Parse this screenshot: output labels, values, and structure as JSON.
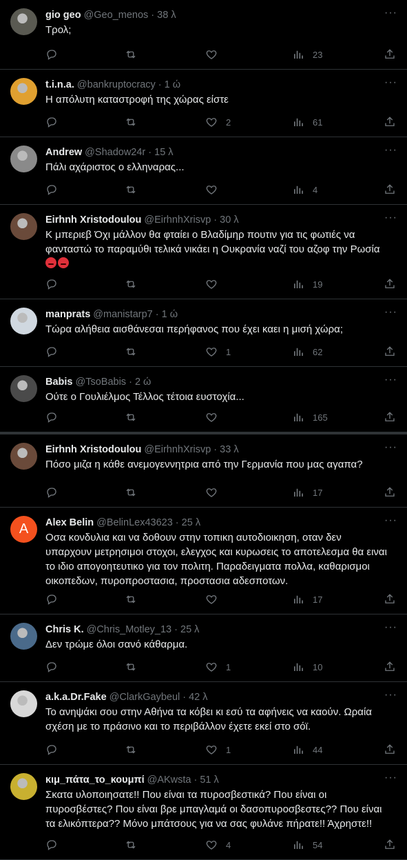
{
  "tweets": [
    {
      "name": "gio geo",
      "meta": "@Geo_menos · 38 λ",
      "text": "Τρολ;",
      "likes": "",
      "views": "23",
      "avatar": "photo",
      "avatar_color": "#5a5a52"
    },
    {
      "name": "t.i.n.a.",
      "meta": "@bankruptocracy · 1 ώ",
      "text": "Η απόλυτη καταστροφή της χώρας είστε",
      "likes": "2",
      "views": "61",
      "avatar": "photo",
      "avatar_color": "#e0a030"
    },
    {
      "name": "Andrew",
      "meta": "@Shadow24r · 15 λ",
      "text": "Πάλι αχάριστος ο ελληναρας...",
      "likes": "",
      "views": "4",
      "avatar": "photo",
      "avatar_color": "#8a8a8a"
    },
    {
      "name": "Eirhnh Xristodoulou",
      "meta": "@EirhnhXrisvp · 30 λ",
      "text": "Κ μπεριεβ Όχι μάλλον θα φταίει ο Βλαδίμηρ πουτιν για τις φωτιές να φανταστώ το παραμύθι τελικά νικάει η Ουκρανία ναζί του αζοφ την Ρωσία",
      "emoji_count": 2,
      "likes": "",
      "views": "19",
      "avatar": "photo",
      "avatar_color": "#6a4a3a"
    },
    {
      "name": "manprats",
      "meta": "@manistarp7 · 1 ώ",
      "text": "Τώρα αλήθεια αισθάνεσαι περήφανος που έχει καει η μισή χώρα;",
      "likes": "1",
      "views": "62",
      "avatar": "photo",
      "avatar_color": "#d0d8e0"
    },
    {
      "name": "Babis",
      "meta": "@TsoBabis · 2 ώ",
      "text": "Ούτε ο Γουλιέλμος Τέλλος τέτοια ευστοχία...",
      "likes": "",
      "views": "165",
      "avatar": "photo",
      "avatar_color": "#4a4a4a"
    },
    {
      "name": "Eirhnh Xristodoulou",
      "meta": "@EirhnhXrisvp · 33 λ",
      "text": "Πόσο μιζα η κάθε ανεμογεννητρια από την Γερμανία που μας αγαπα?",
      "likes": "",
      "views": "17",
      "avatar": "photo",
      "avatar_color": "#6a4a3a"
    },
    {
      "name": "Alex Belin",
      "meta": "@BelinLex43623 · 25 λ",
      "text": "Οσα κονδυλια και να δοθουν στην τοπικη αυτοδιοικηση, οταν δεν υπαρχουν μετρησιμοι στοχοι, ελεγχος και κυρωσεις το αποτελεσμα θα ειναι το ιδιο απογοητευτικο για τον πολιτη. Παραδειγματα πολλα, καθαρισμοι οικοπεδων, πυροπροστασια, προστασια αδεσποτων.",
      "likes": "",
      "views": "17",
      "avatar": "letter",
      "avatar_letter": "A",
      "avatar_color": "#f4511e"
    },
    {
      "name": "Chris K.",
      "meta": "@Chris_Motley_13 · 25 λ",
      "text": "Δεν τρώμε όλοι σανό κάθαρμα.",
      "likes": "1",
      "views": "10",
      "avatar": "photo",
      "avatar_color": "#4a6a8a"
    },
    {
      "name": "a.k.a.Dr.Fake",
      "meta": "@ClarkGaybeul · 42 λ",
      "text": "Το ανηψάκι σου στην Αθήνα τα κόβει κι εσύ τα αφήνεις να καούν. Ωραία σχέση με το πράσινο και το περιβάλλον έχετε εκεί στο σόϊ.",
      "likes": "1",
      "views": "44",
      "avatar": "photo",
      "avatar_color": "#d8d8d8"
    },
    {
      "name": "κιμ_πάτα_το_κουμπί",
      "meta": "@AKwsta · 51 λ",
      "text": "Σκατα υλοποιησατε!! Που είναι τα πυροσβεστικά? Που είναι οι πυροσβέστες? Που είναι βρε μπαγλαμά οι δασοπυροσβεστες?? Που είναι τα ελικόπτερα?? Μόνο μπάτσους για να σας φυλάνε πήρατε!! Άχρηστε!!",
      "likes": "4",
      "views": "54",
      "avatar": "photo",
      "avatar_color": "#c8b030"
    }
  ],
  "icons": {
    "reply": "reply-icon",
    "retweet": "retweet-icon",
    "like": "heart-icon",
    "views": "views-icon",
    "share": "share-icon",
    "more": "more-icon"
  }
}
